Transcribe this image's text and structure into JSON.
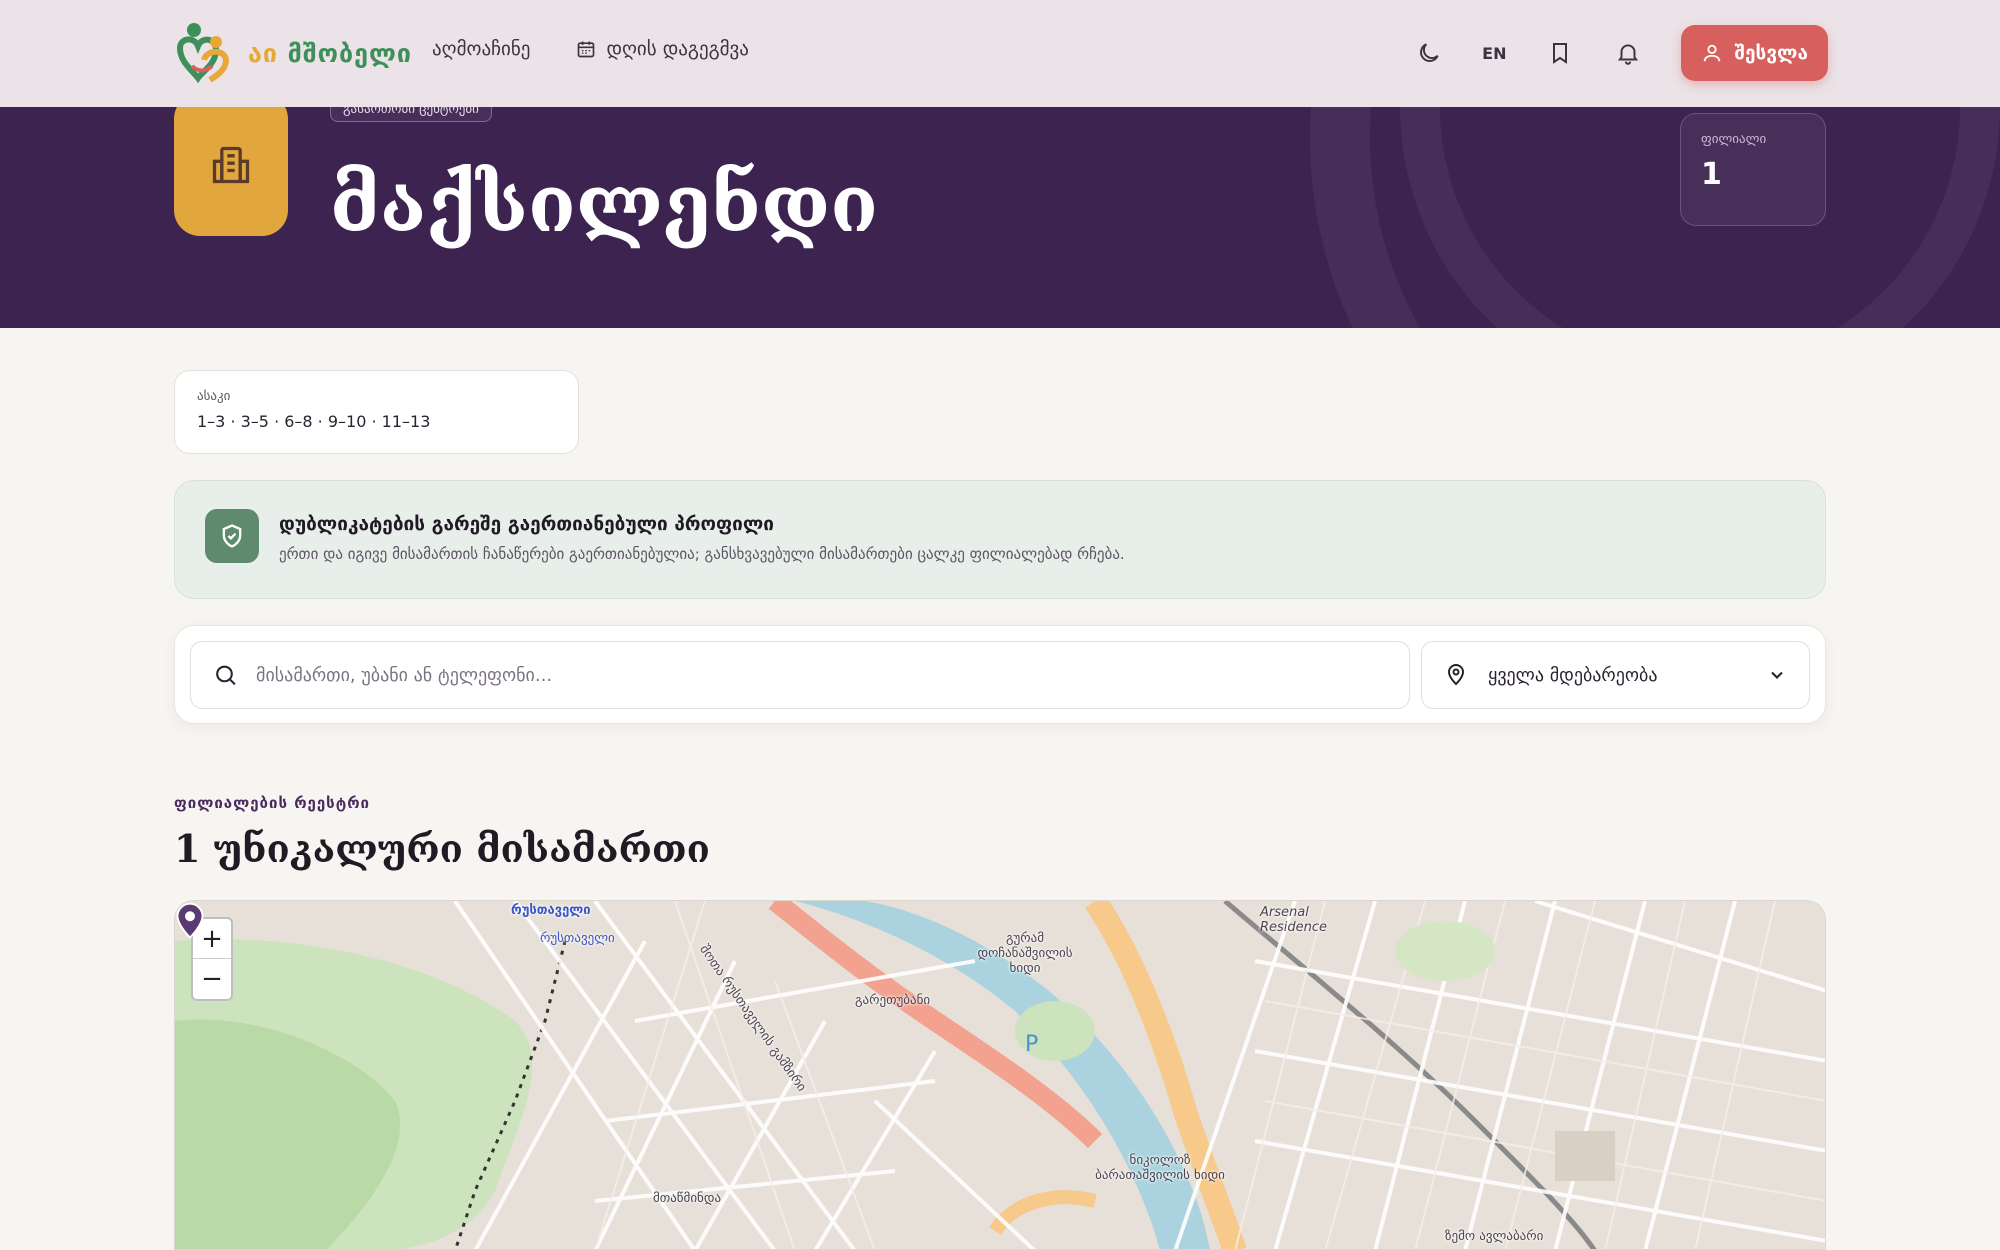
{
  "header": {
    "logo_text_a": "აი ",
    "logo_text_b": "მშობელი",
    "nav": {
      "discover": "აღმოაჩინე",
      "day_planning": "დღის დაგეგმვა"
    },
    "lang": "EN",
    "login": "შესვლა"
  },
  "hero": {
    "category": "გასართობი ცენტრები",
    "title": "მაქსილენდი",
    "branch_label": "ფილიალი",
    "branch_count": "1"
  },
  "age": {
    "label": "ასაკი",
    "value": "1–3 · 3–5 · 6–8 · 9–10 · 11–13"
  },
  "info": {
    "title": "დუბლიკატების გარეშე გაერთიანებული პროფილი",
    "description": "ერთი და იგივე მისამართის ჩანაწერები გაერთიანებულია; განსხვავებული მისამართები ცალკე ფილიალებად რჩება."
  },
  "search": {
    "placeholder": "მისამართი, უბანი ან ტელეფონი...",
    "location_value": "ყველა მდებარეობა"
  },
  "registry": {
    "label": "ფილიალების რეესტრი",
    "title": "1 უნიკალური მისამართი"
  },
  "map": {
    "zoom_in": "+",
    "zoom_out": "−",
    "labels": {
      "rustaveli_1": "რუსთაველი",
      "rustaveli_2": "რუსთაველი",
      "arsenal": "Arsenal Residence",
      "bridge_1": "გურამ დოჩანაშვილის ხიდი",
      "garetubani": "გარეთუბანი",
      "street_1": "შოთა რუსთაველის გამზირი",
      "bridge_2": "ნიკოლოზ ბარათაშვილის ხიდი",
      "mtatsminda": "მთაწმინდა",
      "zemo_avlabari": "ზემო ავლაბარი"
    }
  },
  "colors": {
    "accent": "#d7605f",
    "hero_bg": "#3d2350",
    "hero_icon": "#e2a73c",
    "info_icon": "#5e8a6d",
    "pin": "#5a3a72"
  }
}
